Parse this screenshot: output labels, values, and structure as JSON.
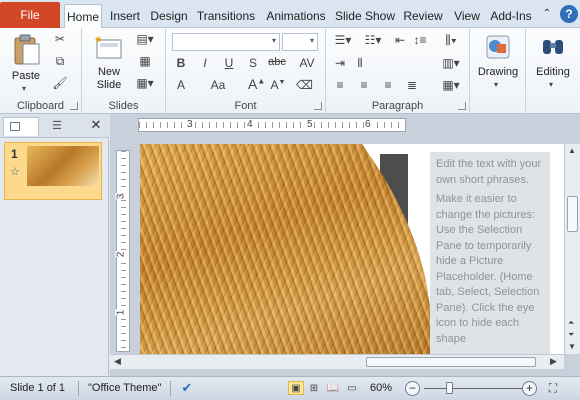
{
  "tabs": {
    "file": "File",
    "items": [
      "Home",
      "Insert",
      "Design",
      "Transitions",
      "Animations",
      "Slide Show",
      "Review",
      "View",
      "Add-Ins"
    ],
    "active": "Home",
    "help": "?"
  },
  "ribbon": {
    "clipboard": {
      "label": "Clipboard",
      "paste": "Paste"
    },
    "slides": {
      "label": "Slides",
      "new_slide_line1": "New",
      "new_slide_line2": "Slide"
    },
    "font": {
      "label": "Font",
      "bold": "B",
      "italic": "I",
      "underline": "U",
      "shadow": "S",
      "strike": "abc",
      "grow": "A",
      "change_case": "Aa"
    },
    "paragraph": {
      "label": "Paragraph"
    },
    "drawing": {
      "label": "Drawing"
    },
    "editing": {
      "label": "Editing"
    }
  },
  "thumbnails": [
    {
      "number": "1",
      "star": "☆"
    }
  ],
  "ruler": {
    "h_marks": [
      "3",
      "4",
      "5",
      "6"
    ],
    "v_marks": [
      "3",
      "2",
      "1"
    ]
  },
  "slide": {
    "text_paragraphs": [
      "Edit the text with your own short phrases.",
      "Make it easier to change the pictures: Use the Selection Pane to temporarily hide a Picture Placeholder. (Home tab, Select, Selection Pane). Click the eye icon to hide each shape"
    ]
  },
  "status": {
    "slide_info": "Slide 1 of 1",
    "theme": "\"Office Theme\"",
    "zoom": "60%",
    "zoom_value": 60
  },
  "colors": {
    "file_tab": "#d24726",
    "accent": "#2e6fb7",
    "active_view": "#fde89a"
  }
}
